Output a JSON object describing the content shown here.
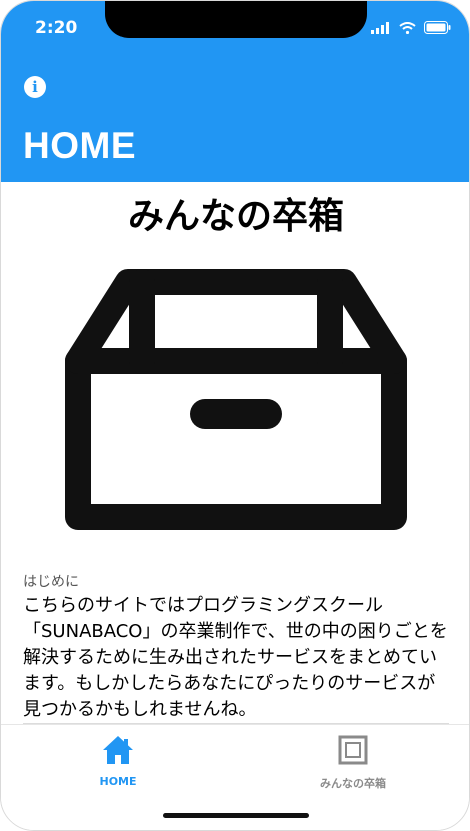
{
  "status_bar": {
    "time": "2:20"
  },
  "header": {
    "title": "HOME",
    "info_icon": "info-icon"
  },
  "main": {
    "app_title": "みんなの卒箱",
    "hero_icon": "box-icon",
    "intro_label": "はじめに",
    "intro_text": "こちらのサイトではプログラミングスクール「SUNABACO」の卒業制作で、世の中の困りごとを解決するために生み出されたサービスをまとめています。もしかしたらあなたにぴったりのサービスが見つかるかもしれませんね。"
  },
  "tabs": [
    {
      "label": "HOME",
      "icon": "home-icon",
      "active": true
    },
    {
      "label": "みんなの卒箱",
      "icon": "box-outline-icon",
      "active": false
    }
  ],
  "colors": {
    "accent": "#2196f3",
    "inactive": "#8a8a8a"
  }
}
